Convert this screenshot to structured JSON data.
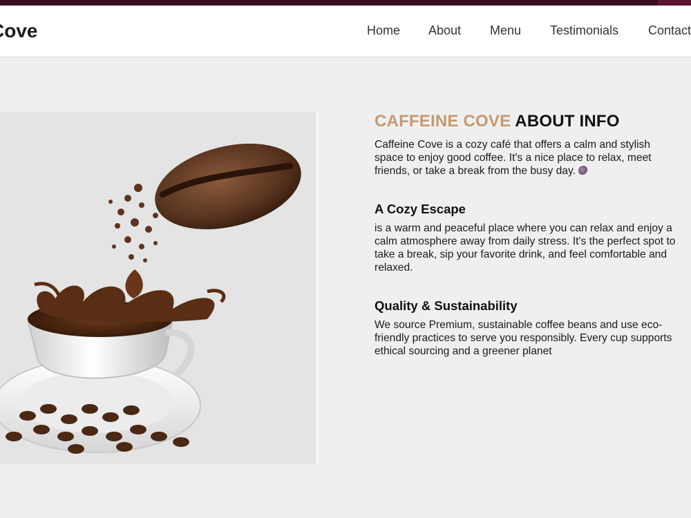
{
  "header": {
    "brand": "Cove",
    "nav": [
      "Home",
      "About",
      "Menu",
      "Testimonials",
      "Contact"
    ]
  },
  "hero_image": {
    "icon": "coffee-cup-splash-illustration"
  },
  "about": {
    "title_accent": "CAFFEINE COVE",
    "title_rest": "ABOUT INFO",
    "intro": "Caffeine Cove is a cozy café that offers a calm and stylish space to enjoy good coffee. It's a nice place to relax, meet friends, or take a break from the busy day.",
    "sections": [
      {
        "heading": "A Cozy Escape",
        "text": "is a warm and peaceful place where you can relax and enjoy a calm atmosphere away from daily stress. It's the perfect spot to take a break, sip your favorite drink, and feel comfortable and relaxed."
      },
      {
        "heading": "Quality & Sustainability",
        "text": "We source Premium, sustainable coffee beans and use eco-friendly practices to serve you responsibly. Every cup supports ethical sourcing and a greener planet"
      }
    ]
  },
  "colors": {
    "accent": "#c49a72",
    "topbar": "#3b0d22",
    "background": "#efefef"
  }
}
